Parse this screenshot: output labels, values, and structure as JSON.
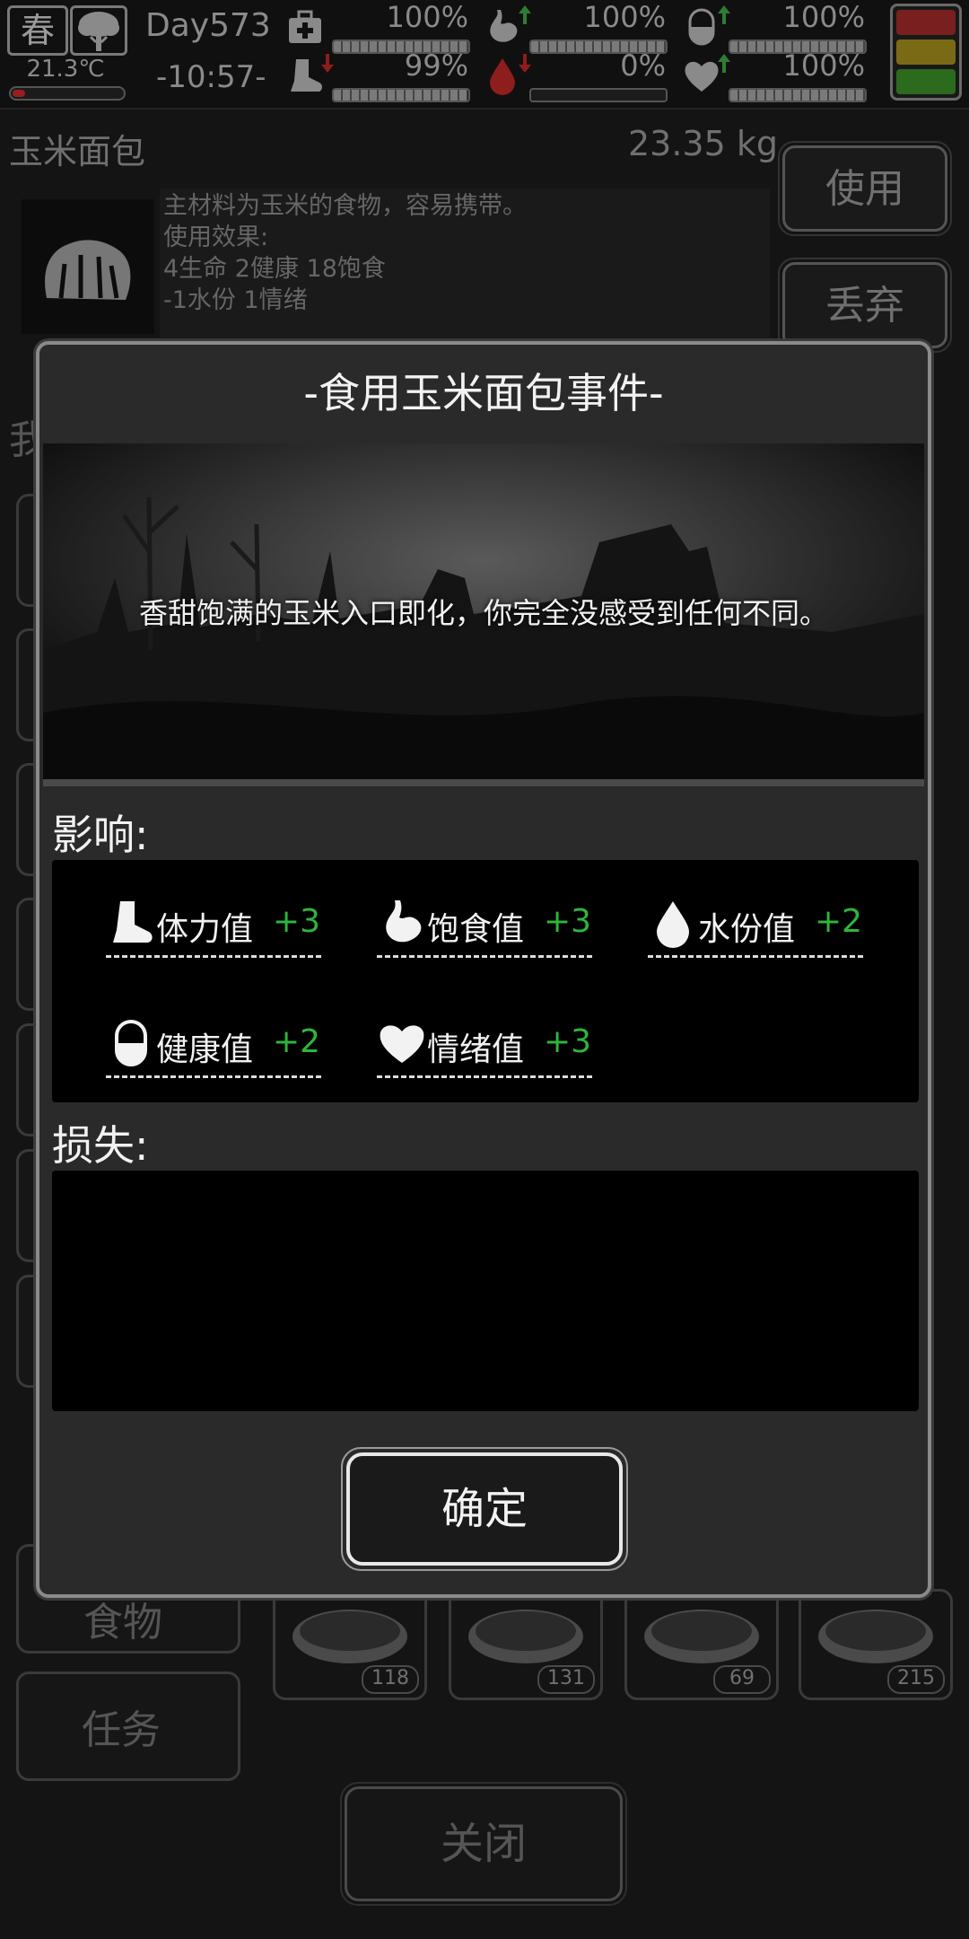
{
  "hud": {
    "season": "春",
    "weather_icon": "tree-storm-icon",
    "temperature": "21.3℃",
    "day": "Day573",
    "time": "-10:57-",
    "stats": [
      {
        "name": "medkit",
        "icon": "medkit-icon",
        "percent": "100%",
        "level": 1.0,
        "trend": "none"
      },
      {
        "name": "stomach",
        "icon": "stomach-icon",
        "percent": "100%",
        "level": 1.0,
        "trend": "up"
      },
      {
        "name": "pill",
        "icon": "pill-icon",
        "percent": "100%",
        "level": 1.0,
        "trend": "up"
      },
      {
        "name": "boot",
        "icon": "boot-icon",
        "percent": "99%",
        "level": 0.99,
        "trend": "down"
      },
      {
        "name": "water",
        "icon": "water-drop-icon",
        "percent": "0%",
        "level": 0.0,
        "trend": "down"
      },
      {
        "name": "heart",
        "icon": "heart-icon",
        "percent": "100%",
        "level": 1.0,
        "trend": "up"
      }
    ],
    "status_colors": [
      "#7a1f1f",
      "#7a6a16",
      "#2c6a1e"
    ]
  },
  "item": {
    "name": "玉米面包",
    "weight": "23.35 kg",
    "icon": "bread-icon",
    "description_lines": [
      "主材料为玉米的食物，容易携带。",
      "使用效果:",
      "4生命 2健康 18饱食",
      "-1水份 1情绪"
    ],
    "use_label": "使用",
    "discard_label": "丢弃"
  },
  "background": {
    "side_labels": [
      "我",
      "食物",
      "任务"
    ],
    "slot_counts": [
      "118",
      "131",
      "69",
      "215"
    ],
    "close_label": "关闭"
  },
  "modal": {
    "title": "-食用玉米面包事件-",
    "scene_text": "香甜饱满的玉米入口即化，你完全没感受到任何不同。",
    "effects_label": "影响:",
    "effects": [
      {
        "icon": "boot-icon",
        "name": "体力值",
        "value": "+3"
      },
      {
        "icon": "stomach-icon",
        "name": "饱食值",
        "value": "+3"
      },
      {
        "icon": "water-drop-icon",
        "name": "水份值",
        "value": "+2"
      },
      {
        "icon": "pill-icon",
        "name": "健康值",
        "value": "+2"
      },
      {
        "icon": "heart-icon",
        "name": "情绪值",
        "value": "+3"
      }
    ],
    "losses_label": "损失:",
    "losses": [],
    "confirm_label": "确定"
  }
}
